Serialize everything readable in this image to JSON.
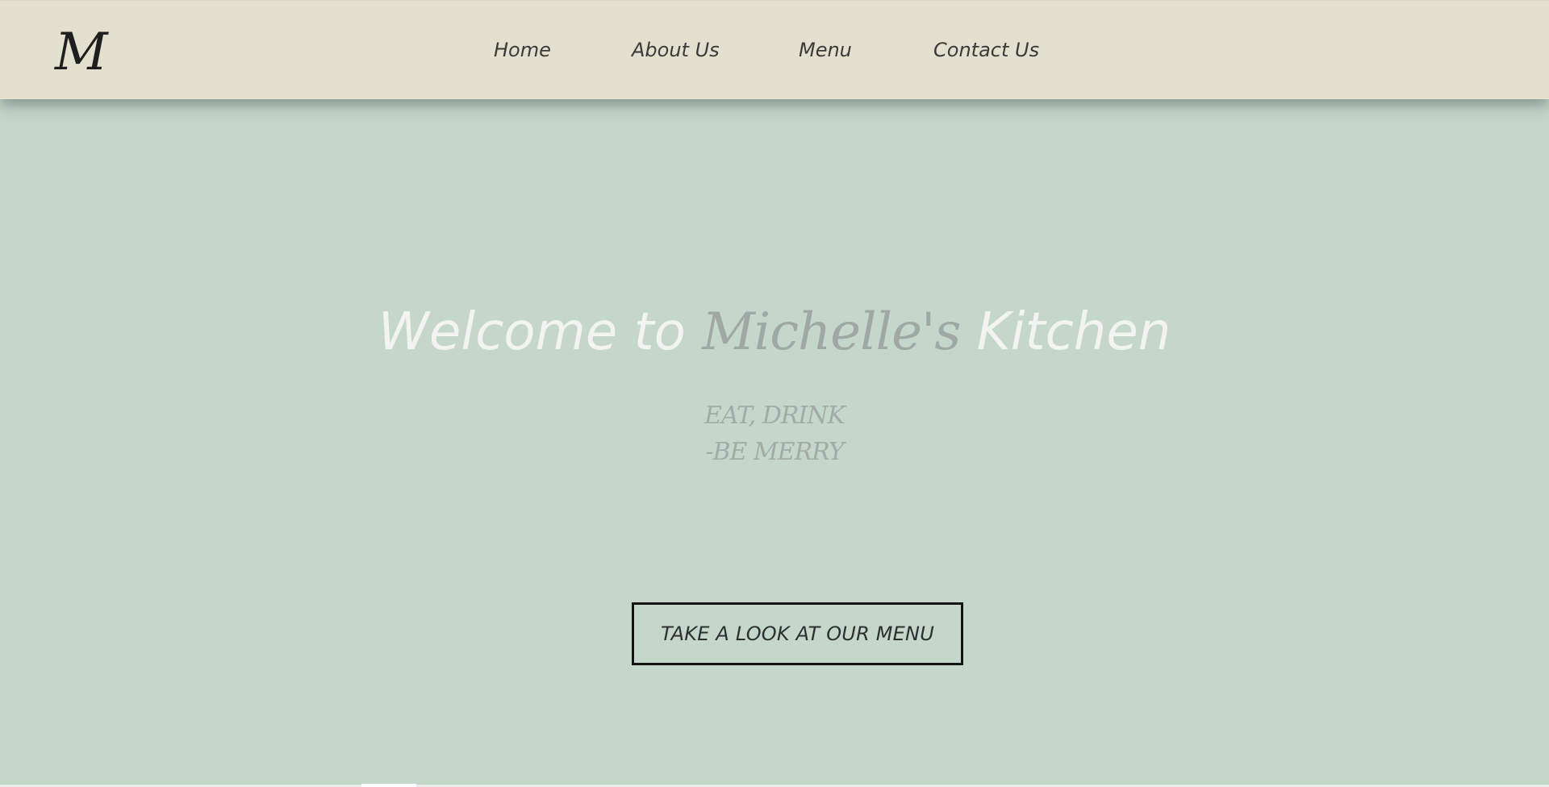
{
  "header": {
    "logo_text": "M",
    "nav": [
      {
        "label": "Home"
      },
      {
        "label": "About Us"
      },
      {
        "label": "Menu"
      },
      {
        "label": "Contact Us"
      }
    ]
  },
  "hero": {
    "title_prefix": "Welcome to ",
    "title_brand": "Michelle's",
    "title_suffix": " Kitchen",
    "tagline_line1": "EAT, DRINK",
    "tagline_line2": "-BE MERRY",
    "cta_label": "TAKE A LOOK AT OUR MENU"
  },
  "colors": {
    "header_bg": "#e3e0cf",
    "page_bg": "#c5d6cb",
    "title_white": "#f3f4ef",
    "brand_gray": "#9fa8a2",
    "button_border": "#141414"
  }
}
